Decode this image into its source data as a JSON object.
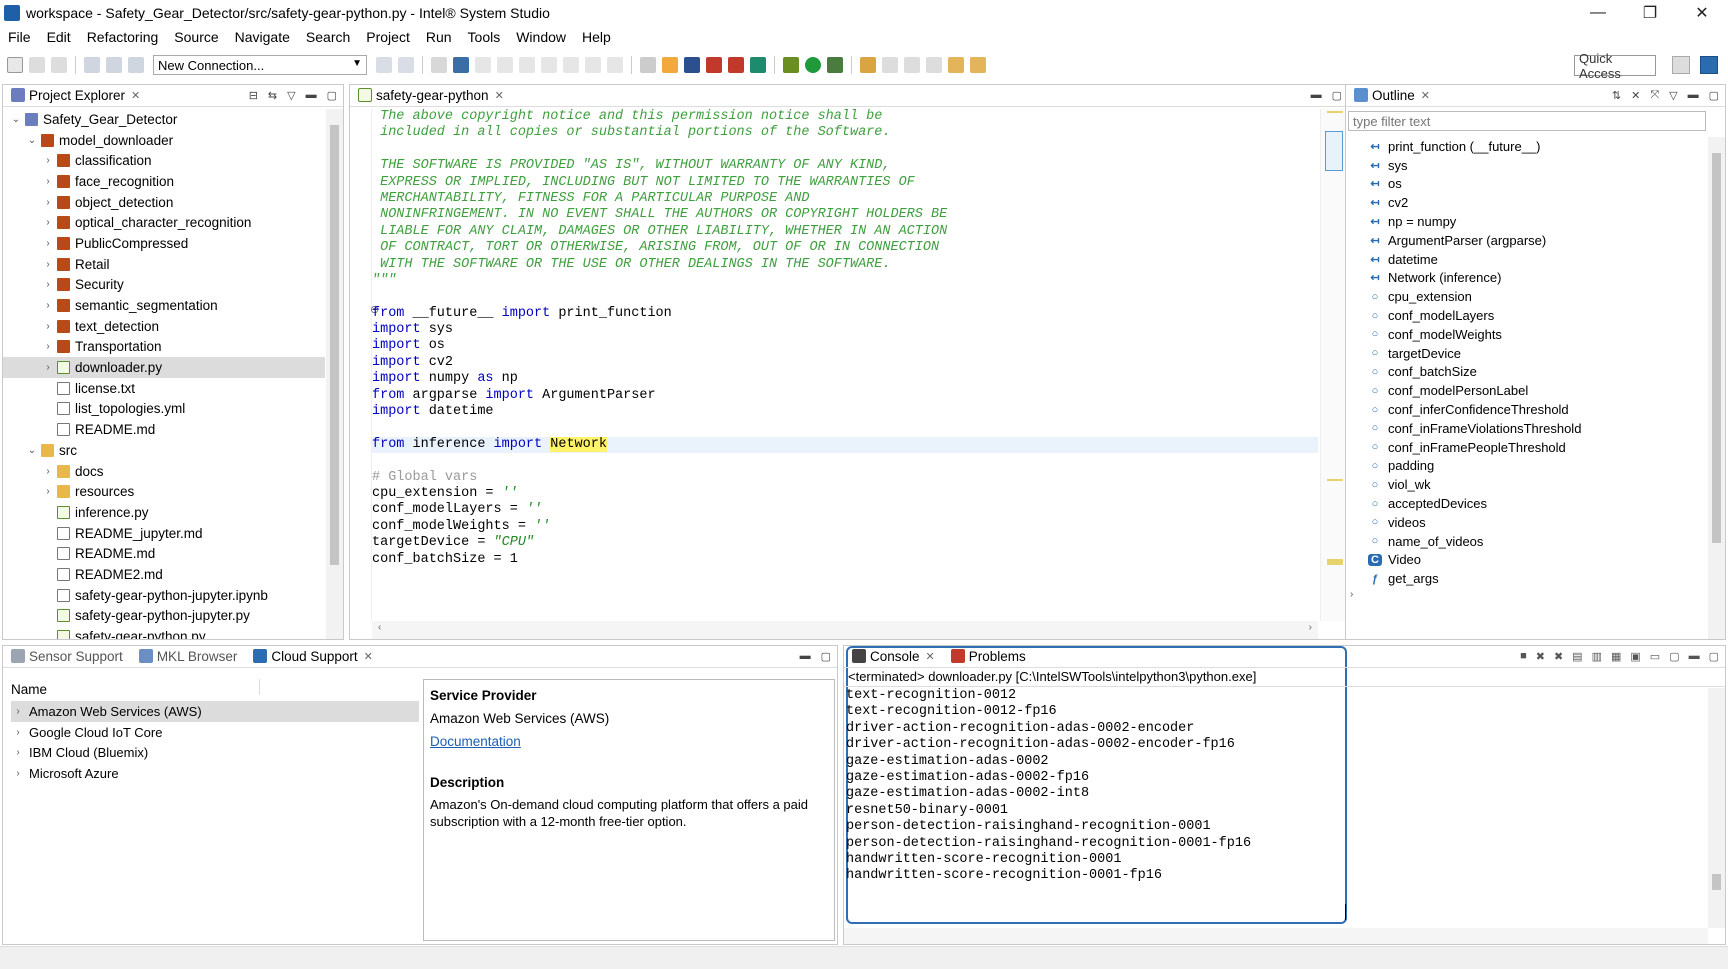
{
  "window": {
    "title": "workspace - Safety_Gear_Detector/src/safety-gear-python.py - Intel® System Studio",
    "minimize": "—",
    "maximize": "❐",
    "close": "✕"
  },
  "menu": [
    "File",
    "Edit",
    "Refactoring",
    "Source",
    "Navigate",
    "Search",
    "Project",
    "Run",
    "Tools",
    "Window",
    "Help"
  ],
  "toolbar": {
    "connection_label": "New Connection...",
    "quick_access": "Quick Access"
  },
  "project_explorer": {
    "tab_label": "Project Explorer",
    "nodes": [
      {
        "label": "Safety_Gear_Detector",
        "arrow": "⌄",
        "icon": "project-icon"
      },
      {
        "label": "model_downloader",
        "arrow": "⌄",
        "icon": "package-icon"
      },
      {
        "label": "classification",
        "arrow": "›",
        "icon": "package-icon"
      },
      {
        "label": "face_recognition",
        "arrow": "›",
        "icon": "package-icon"
      },
      {
        "label": "object_detection",
        "arrow": "›",
        "icon": "package-icon"
      },
      {
        "label": "optical_character_recognition",
        "arrow": "›",
        "icon": "package-icon"
      },
      {
        "label": "PublicCompressed",
        "arrow": "›",
        "icon": "package-icon"
      },
      {
        "label": "Retail",
        "arrow": "›",
        "icon": "package-icon"
      },
      {
        "label": "Security",
        "arrow": "›",
        "icon": "package-icon"
      },
      {
        "label": "semantic_segmentation",
        "arrow": "›",
        "icon": "package-icon"
      },
      {
        "label": "text_detection",
        "arrow": "›",
        "icon": "package-icon"
      },
      {
        "label": "Transportation",
        "arrow": "›",
        "icon": "package-icon"
      },
      {
        "label": "downloader.py",
        "arrow": "›",
        "icon": "python-file-icon",
        "selected": true
      },
      {
        "label": "license.txt",
        "arrow": "",
        "icon": "file-icon"
      },
      {
        "label": "list_topologies.yml",
        "arrow": "",
        "icon": "file-icon"
      },
      {
        "label": "README.md",
        "arrow": "",
        "icon": "file-icon"
      },
      {
        "label": "src",
        "arrow": "⌄",
        "icon": "folder-icon"
      },
      {
        "label": "docs",
        "arrow": "›",
        "icon": "folder-icon"
      },
      {
        "label": "resources",
        "arrow": "›",
        "icon": "folder-icon"
      },
      {
        "label": "inference.py",
        "arrow": "",
        "icon": "python-file-icon"
      },
      {
        "label": "README_jupyter.md",
        "arrow": "",
        "icon": "file-icon"
      },
      {
        "label": "README.md",
        "arrow": "",
        "icon": "file-icon"
      },
      {
        "label": "README2.md",
        "arrow": "",
        "icon": "file-icon"
      },
      {
        "label": "safety-gear-python-jupyter.ipynb",
        "arrow": "",
        "icon": "file-icon"
      },
      {
        "label": "safety-gear-python-jupyter.py",
        "arrow": "",
        "icon": "python-file-icon"
      },
      {
        "label": "safety-gear-python.py",
        "arrow": "",
        "icon": "python-file-icon"
      }
    ]
  },
  "editor": {
    "tab_label": "safety-gear-python",
    "lines": [
      [
        {
          "t": " The above copyright notice and this permission notice shall be",
          "c": "cm"
        }
      ],
      [
        {
          "t": " included in all copies or substantial portions of the Software.",
          "c": "cm"
        }
      ],
      [
        {
          "t": "",
          "c": ""
        }
      ],
      [
        {
          "t": " THE SOFTWARE IS PROVIDED \"AS IS\", WITHOUT WARRANTY OF ANY KIND,",
          "c": "cm"
        }
      ],
      [
        {
          "t": " EXPRESS OR IMPLIED, INCLUDING BUT NOT LIMITED TO THE WARRANTIES OF",
          "c": "cm"
        }
      ],
      [
        {
          "t": " MERCHANTABILITY, FITNESS FOR A PARTICULAR PURPOSE AND",
          "c": "cm"
        }
      ],
      [
        {
          "t": " NONINFRINGEMENT. IN NO EVENT SHALL THE AUTHORS OR COPYRIGHT HOLDERS BE",
          "c": "cm"
        }
      ],
      [
        {
          "t": " LIABLE FOR ANY CLAIM, DAMAGES OR OTHER LIABILITY, WHETHER IN AN ACTION",
          "c": "cm"
        }
      ],
      [
        {
          "t": " OF CONTRACT, TORT OR OTHERWISE, ARISING FROM, OUT OF OR IN CONNECTION",
          "c": "cm"
        }
      ],
      [
        {
          "t": " WITH THE SOFTWARE OR THE USE OR OTHER DEALINGS IN THE SOFTWARE.",
          "c": "cm"
        }
      ],
      [
        {
          "t": "\"\"\"",
          "c": "cm"
        }
      ],
      [
        {
          "t": "",
          "c": ""
        }
      ],
      [
        {
          "t": "from",
          "c": "kw"
        },
        {
          "t": " __future__ ",
          "c": ""
        },
        {
          "t": "import",
          "c": "kw"
        },
        {
          "t": " print_function",
          "c": ""
        }
      ],
      [
        {
          "t": "import",
          "c": "kw"
        },
        {
          "t": " sys",
          "c": ""
        }
      ],
      [
        {
          "t": "import",
          "c": "kw"
        },
        {
          "t": " os",
          "c": ""
        }
      ],
      [
        {
          "t": "import",
          "c": "kw"
        },
        {
          "t": " cv2",
          "c": ""
        }
      ],
      [
        {
          "t": "import",
          "c": "kw"
        },
        {
          "t": " numpy ",
          "c": ""
        },
        {
          "t": "as",
          "c": "kw"
        },
        {
          "t": " np",
          "c": ""
        }
      ],
      [
        {
          "t": "from",
          "c": "kw"
        },
        {
          "t": " argparse ",
          "c": ""
        },
        {
          "t": "import",
          "c": "kw"
        },
        {
          "t": " ArgumentParser",
          "c": ""
        }
      ],
      [
        {
          "t": "import",
          "c": "kw"
        },
        {
          "t": " datetime",
          "c": ""
        }
      ],
      [
        {
          "t": "",
          "c": ""
        }
      ],
      [
        {
          "t": "from",
          "c": "kw"
        },
        {
          "t": " inference ",
          "c": ""
        },
        {
          "t": "import",
          "c": "kw"
        },
        {
          "t": " ",
          "c": ""
        },
        {
          "t": "Network",
          "c": "hl"
        }
      ],
      [
        {
          "t": "",
          "c": ""
        }
      ],
      [
        {
          "t": "# Global vars",
          "c": "gray"
        }
      ],
      [
        {
          "t": "cpu_extension = ",
          "c": ""
        },
        {
          "t": "''",
          "c": "st"
        }
      ],
      [
        {
          "t": "conf_modelLayers = ",
          "c": ""
        },
        {
          "t": "''",
          "c": "st"
        }
      ],
      [
        {
          "t": "conf_modelWeights = ",
          "c": ""
        },
        {
          "t": "''",
          "c": "st"
        }
      ],
      [
        {
          "t": "targetDevice = ",
          "c": ""
        },
        {
          "t": "\"CPU\"",
          "c": "st"
        }
      ],
      [
        {
          "t": "conf_batchSize = 1",
          "c": ""
        }
      ]
    ]
  },
  "outline": {
    "tab_label": "Outline",
    "filter_placeholder": "type filter text",
    "items": [
      {
        "label": "print_function (__future__)",
        "icon": "import-icon"
      },
      {
        "label": "sys",
        "icon": "import-icon"
      },
      {
        "label": "os",
        "icon": "import-icon"
      },
      {
        "label": "cv2",
        "icon": "import-icon"
      },
      {
        "label": "np = numpy",
        "icon": "import-icon"
      },
      {
        "label": "ArgumentParser (argparse)",
        "icon": "import-icon"
      },
      {
        "label": "datetime",
        "icon": "import-icon"
      },
      {
        "label": "Network (inference)",
        "icon": "import-icon"
      },
      {
        "label": "cpu_extension",
        "icon": "variable-icon"
      },
      {
        "label": "conf_modelLayers",
        "icon": "variable-icon"
      },
      {
        "label": "conf_modelWeights",
        "icon": "variable-icon"
      },
      {
        "label": "targetDevice",
        "icon": "variable-icon"
      },
      {
        "label": "conf_batchSize",
        "icon": "variable-icon"
      },
      {
        "label": "conf_modelPersonLabel",
        "icon": "variable-icon"
      },
      {
        "label": "conf_inferConfidenceThreshold",
        "icon": "variable-icon"
      },
      {
        "label": "conf_inFrameViolationsThreshold",
        "icon": "variable-icon"
      },
      {
        "label": "conf_inFramePeopleThreshold",
        "icon": "variable-icon"
      },
      {
        "label": "padding",
        "icon": "variable-icon"
      },
      {
        "label": "viol_wk",
        "icon": "variable-icon"
      },
      {
        "label": "acceptedDevices",
        "icon": "variable-icon"
      },
      {
        "label": "videos",
        "icon": "variable-icon"
      },
      {
        "label": "name_of_videos",
        "icon": "variable-icon"
      },
      {
        "label": "Video",
        "icon": "class-icon"
      },
      {
        "label": "get_args",
        "icon": "function-icon"
      }
    ]
  },
  "bottom_left": {
    "tabs": [
      "Sensor Support",
      "MKL Browser",
      "Cloud Support"
    ],
    "name_header": "Name",
    "providers": [
      "Amazon Web Services (AWS)",
      "Google Cloud IoT Core",
      "IBM Cloud (Bluemix)",
      "Microsoft Azure"
    ],
    "detail": {
      "provider_heading": "Service Provider",
      "provider_value": "Amazon Web Services (AWS)",
      "doc_link": "Documentation",
      "desc_heading": "Description",
      "desc_text": "Amazon's On-demand cloud computing platform that offers a paid subscription with a 12-month free-tier option."
    }
  },
  "console": {
    "tabs": [
      "Console",
      "Problems"
    ],
    "header": "<terminated> downloader.py [C:\\IntelSWTools\\intelpython3\\python.exe]",
    "lines": [
      "text-recognition-0012",
      "text-recognition-0012-fp16",
      "driver-action-recognition-adas-0002-encoder",
      "driver-action-recognition-adas-0002-encoder-fp16",
      "gaze-estimation-adas-0002",
      "gaze-estimation-adas-0002-fp16",
      "gaze-estimation-adas-0002-int8",
      "resnet50-binary-0001",
      "person-detection-raisinghand-recognition-0001",
      "person-detection-raisinghand-recognition-0001-fp16",
      "handwritten-score-recognition-0001",
      "handwritten-score-recognition-0001-fp16"
    ]
  }
}
